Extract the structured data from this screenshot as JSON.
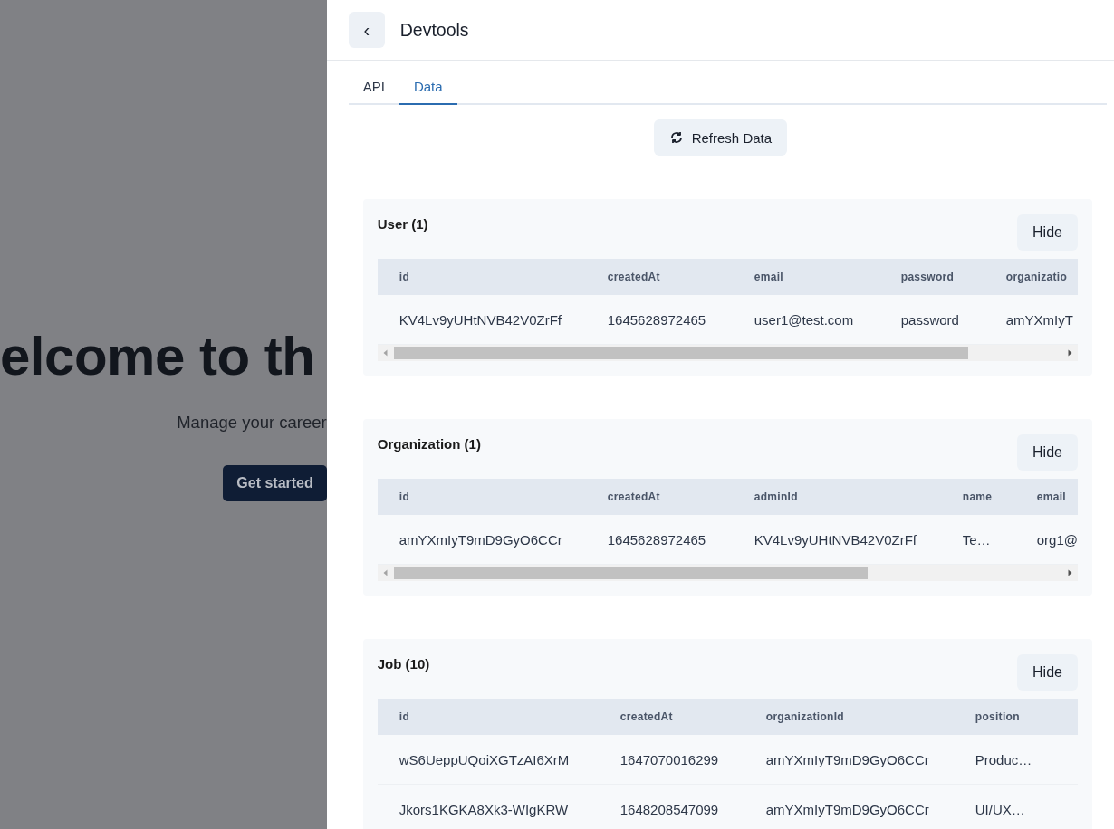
{
  "background_page": {
    "heading": "elcome to th",
    "subtitle": "Manage your career",
    "button": "Get started"
  },
  "drawer": {
    "back_button": "‹",
    "title": "Devtools",
    "tabs": [
      {
        "label": "API",
        "selected": false
      },
      {
        "label": "Data",
        "selected": true
      }
    ],
    "refresh_button": "Refresh Data",
    "sections": [
      {
        "title": "User (1)",
        "hide_button": "Hide",
        "columns": [
          "id",
          "createdAt",
          "email",
          "password",
          "organizatio"
        ],
        "rows": [
          [
            "KV4Lv9yUHtNVB42V0ZrFf",
            "1645628972465",
            "user1@test.com",
            "password",
            "amYXmIyT"
          ]
        ]
      },
      {
        "title": "Organization (1)",
        "hide_button": "Hide",
        "columns": [
          "id",
          "createdAt",
          "adminId",
          "name",
          "email"
        ],
        "rows": [
          [
            "amYXmIyT9mD9GyO6CCr",
            "1645628972465",
            "KV4Lv9yUHtNVB42V0ZrFf",
            "Te…",
            "org1@"
          ]
        ]
      },
      {
        "title": "Job (10)",
        "hide_button": "Hide",
        "columns": [
          "id",
          "createdAt",
          "organizationId",
          "position"
        ],
        "rows": [
          [
            "wS6UeppUQoiXGTzAI6XrM",
            "1647070016299",
            "amYXmIyT9mD9GyO6CCr",
            "Produc…"
          ],
          [
            "Jkors1KGKA8Xk3-WIgKRW",
            "1648208547099",
            "amYXmIyT9mD9GyO6CCr",
            "UI/UX…"
          ]
        ]
      }
    ]
  }
}
